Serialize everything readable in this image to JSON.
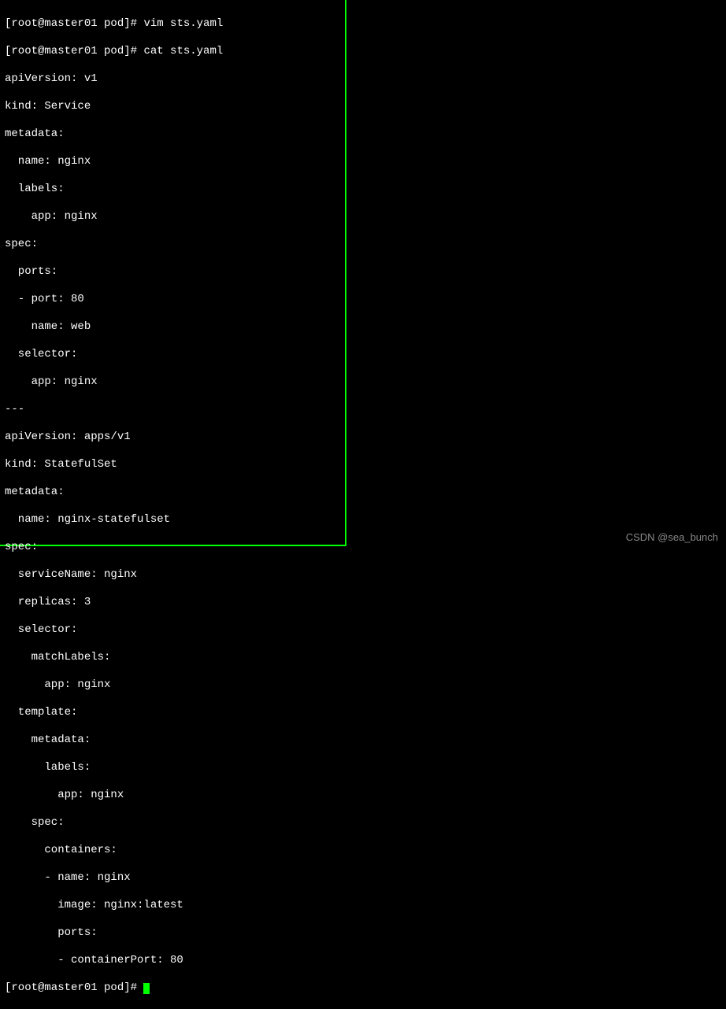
{
  "terminal": {
    "prompt1": "[root@master01 pod]# ",
    "command1": "vim sts.yaml",
    "prompt2": "[root@master01 pod]# ",
    "command2": "cat sts.yaml",
    "yaml": {
      "l01": "apiVersion: v1",
      "l02": "kind: Service",
      "l03": "metadata:",
      "l04": "  name: nginx",
      "l05": "  labels:",
      "l06": "    app: nginx",
      "l07": "spec:",
      "l08": "  ports:",
      "l09": "  - port: 80",
      "l10": "    name: web",
      "l11": "  selector:",
      "l12": "    app: nginx",
      "l13": "---",
      "l14": "apiVersion: apps/v1",
      "l15": "kind: StatefulSet",
      "l16": "metadata:",
      "l17": "  name: nginx-statefulset",
      "l18": "spec:",
      "l19": "  serviceName: nginx",
      "l20": "  replicas: 3",
      "l21": "  selector:",
      "l22": "    matchLabels:",
      "l23": "      app: nginx",
      "l24": "  template:",
      "l25": "    metadata:",
      "l26": "      labels:",
      "l27": "        app: nginx",
      "l28": "    spec:",
      "l29": "      containers:",
      "l30": "      - name: nginx",
      "l31": "        image: nginx:latest",
      "l32": "        ports:",
      "l33": "        - containerPort: 80"
    },
    "prompt3": "[root@master01 pod]# "
  },
  "watermark": "CSDN @sea_bunch"
}
